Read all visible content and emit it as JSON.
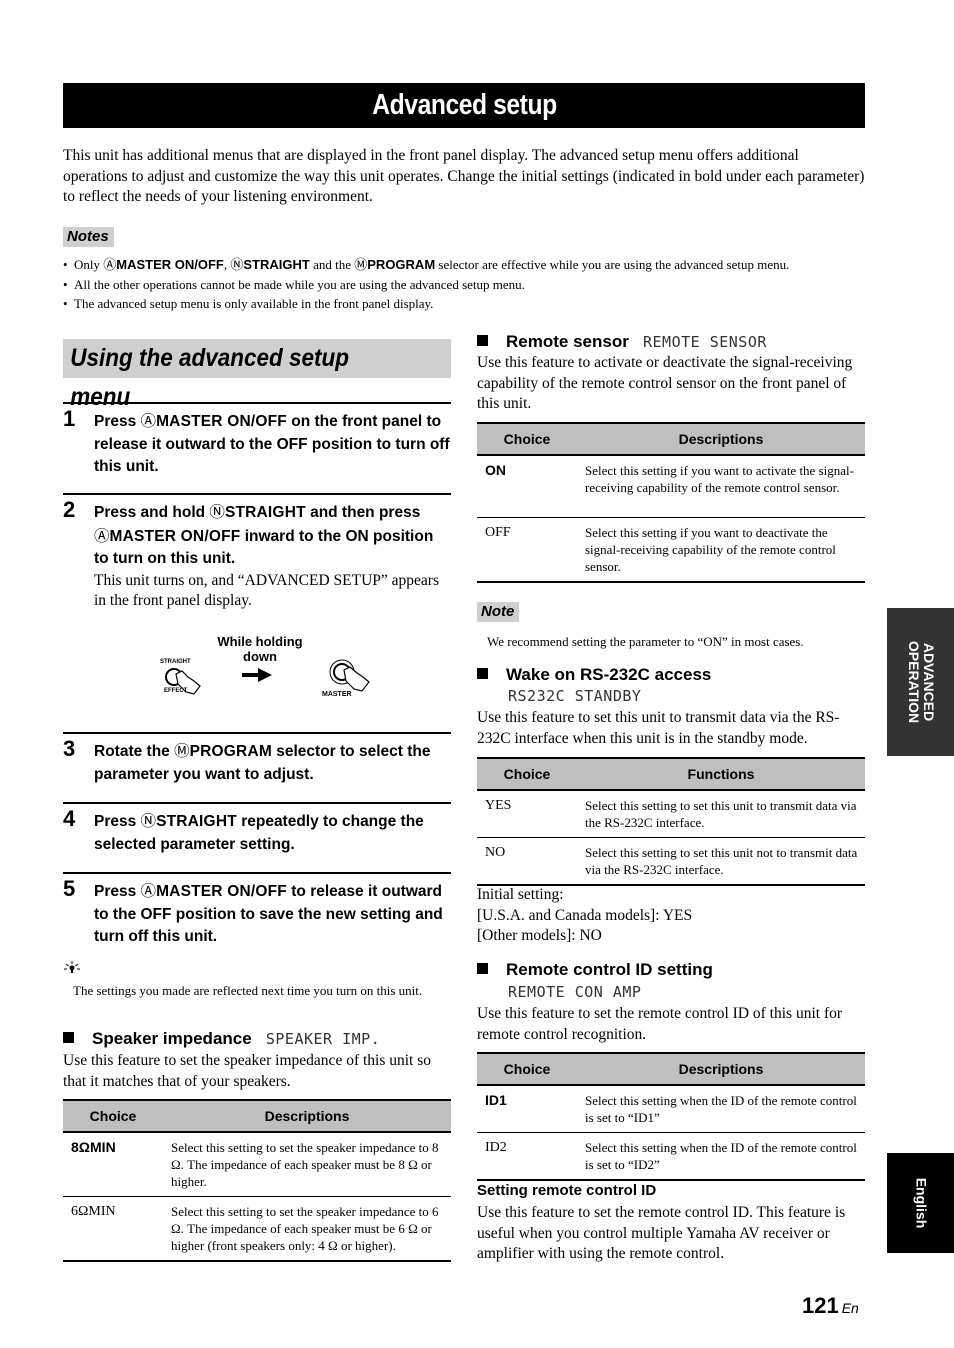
{
  "title": "Advanced setup",
  "intro": "This unit has additional menus that are displayed in the front panel display. The advanced setup menu offers additional operations to adjust and customize the way this unit operates. Change the initial settings (indicated in bold under each parameter) to reflect the needs of your listening environment.",
  "notes": {
    "label": "Notes",
    "items": [
      {
        "prefix": "Only ",
        "key1_icon": "Ⓐ",
        "key1": "MASTER ON/OFF",
        "sep": ", ",
        "key2_icon": "Ⓝ",
        "key2": "STRAIGHT",
        "mid": " and the ",
        "key3_icon": "Ⓜ",
        "key3": "PROGRAM",
        "suffix": " selector are effective while you are using the advanced setup menu."
      },
      {
        "text": "All the other operations cannot be made while you are using the advanced setup menu."
      },
      {
        "text": "The advanced setup menu is only available in the front panel display."
      }
    ]
  },
  "section_heading": "Using the advanced setup menu",
  "steps": [
    {
      "num": "1",
      "pre": "Press ",
      "icon": "Ⓐ",
      "key": "MASTER ON/OFF",
      "post": " on the front panel to release it outward to the OFF position to turn off this unit."
    },
    {
      "num": "2",
      "pre": "Press and hold ",
      "icon": "Ⓝ",
      "key": "STRAIGHT",
      "mid": " and then press ",
      "icon2": "Ⓐ",
      "key2": "MASTER ON/OFF",
      "post": " inward to the ON position to turn on this unit.",
      "sub": "This unit turns on, and “ADVANCED SETUP” appears in the front panel display."
    },
    {
      "num": "3",
      "pre": "Rotate the ",
      "icon": "Ⓜ",
      "key": "PROGRAM",
      "post": " selector to select the parameter you want to adjust."
    },
    {
      "num": "4",
      "pre": "Press ",
      "icon": "Ⓝ",
      "key": "STRAIGHT",
      "post": " repeatedly to change the selected parameter setting."
    },
    {
      "num": "5",
      "pre": "Press ",
      "icon": "Ⓐ",
      "key": "MASTER ON/OFF",
      "post": " to release it outward to the OFF position to save the new setting and turn off this unit."
    }
  ],
  "illustration": {
    "caption": "While holding down",
    "button1_top": "STRAIGHT",
    "button1_bottom": "EFFECT",
    "button2_label": "MASTER"
  },
  "tip": {
    "icon": "lightbulb-icon",
    "text": "The settings you made are reflected next time you turn on this unit."
  },
  "speaker_impedance": {
    "heading": "Speaker impedance",
    "display": "SPEAKER IMP.",
    "desc": "Use this feature to set the speaker impedance of this unit so that it matches that of your speakers.",
    "columns": [
      "Choice",
      "Descriptions"
    ],
    "rows": [
      {
        "choice": "8ΩMIN",
        "bold": true,
        "desc": "Select this setting to set the speaker impedance to 8 Ω. The impedance of each speaker must be 8 Ω or higher."
      },
      {
        "choice": "6ΩMIN",
        "bold": false,
        "desc": "Select this setting to set the speaker impedance to 6 Ω. The impedance of each speaker must be 6 Ω or higher (front speakers only: 4 Ω or higher)."
      }
    ]
  },
  "remote_sensor": {
    "heading": "Remote sensor",
    "display": "REMOTE SENSOR",
    "desc": "Use this feature to activate or deactivate the signal-receiving capability of the remote control sensor on the front panel of this unit.",
    "columns": [
      "Choice",
      "Descriptions"
    ],
    "rows": [
      {
        "choice": "ON",
        "bold": true,
        "desc": "Select this setting if you want to activate the signal-receiving capability of the remote control sensor."
      },
      {
        "choice": "OFF",
        "bold": false,
        "desc": "Select this setting if you want to deactivate the signal-receiving capability of the remote control sensor."
      }
    ],
    "note_label": "Note",
    "note": "We recommend setting the parameter to “ON” in most cases."
  },
  "wake_rs232c": {
    "heading": "Wake on RS-232C access",
    "display": "RS232C STANDBY",
    "desc": "Use this feature to set this unit to transmit data via the RS-232C interface when this unit is in the standby mode.",
    "columns": [
      "Choice",
      "Functions"
    ],
    "rows": [
      {
        "choice": "YES",
        "bold": false,
        "desc": "Select this setting to set this unit to transmit data via the RS-232C interface."
      },
      {
        "choice": "NO",
        "bold": false,
        "desc": "Select this setting to set this unit not to transmit data via the RS-232C interface."
      }
    ],
    "initial_lines": [
      "Initial setting:",
      "[U.S.A. and Canada models]: YES",
      "[Other models]: NO"
    ]
  },
  "remote_id": {
    "heading": "Remote control ID setting",
    "display": "REMOTE CON AMP",
    "desc": "Use this feature to set the remote control ID of this unit for remote control recognition.",
    "columns": [
      "Choice",
      "Descriptions"
    ],
    "rows": [
      {
        "choice": "ID1",
        "bold": true,
        "desc": "Select this setting when the ID of the remote control is set to “ID1”"
      },
      {
        "choice": "ID2",
        "bold": false,
        "desc": "Select this setting when the ID of the remote control is set to “ID2”"
      }
    ],
    "sub_heading": "Setting remote control ID",
    "sub_desc": "Use this feature to set the remote control ID. This feature is useful when you control multiple Yamaha AV receiver or amplifier with using the remote control."
  },
  "side_tabs": {
    "advanced_line1": "ADVANCED",
    "advanced_line2": "OPERATION",
    "english": "English"
  },
  "page": {
    "number": "121",
    "lang": "En"
  }
}
